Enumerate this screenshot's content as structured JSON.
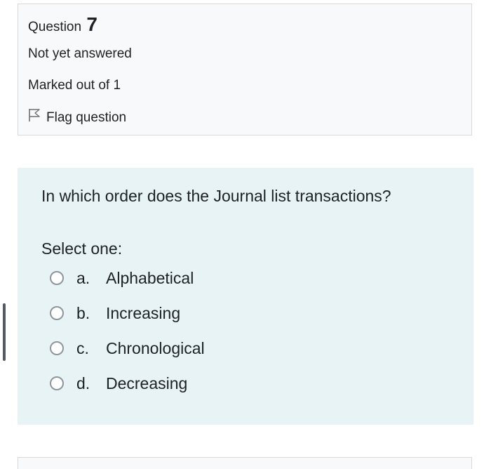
{
  "question_info": {
    "label": "Question",
    "number": "7",
    "state": "Not yet answered",
    "grade": "Marked out of 1",
    "flag_label": "Flag question"
  },
  "question": {
    "text": "In which order does the Journal list transactions?",
    "prompt": "Select one:",
    "answers": [
      {
        "letter": "a.",
        "text": "Alphabetical"
      },
      {
        "letter": "b.",
        "text": "Increasing"
      },
      {
        "letter": "c.",
        "text": "Chronological"
      },
      {
        "letter": "d.",
        "text": "Decreasing"
      }
    ]
  },
  "icons": {
    "flag": "flag-outline-icon",
    "radio": "radio-unchecked-icon"
  },
  "colors": {
    "info_background": "#f8f9fa",
    "content_background": "#e7f3f5",
    "border": "#d9d9d9",
    "text": "#1d2125"
  }
}
